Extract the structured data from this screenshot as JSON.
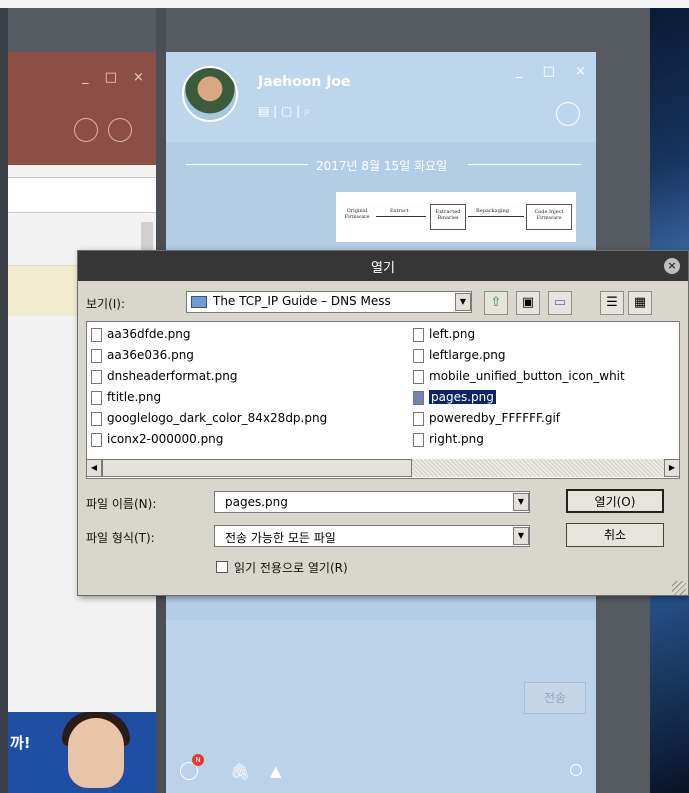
{
  "chat": {
    "username": "Jaehoon Joe",
    "toolbar_icons": "▤ | ▢ | ⌕",
    "window_controls": "_ □ ×",
    "date": "2017년 8월 15일 화요일",
    "send_label": "전송",
    "emoji_badge": "N",
    "diagram": {
      "box1": "Original Firmware",
      "arrow1": "Extract",
      "box2": "Extracted Binaries",
      "arrow2": "Repackaging",
      "box3": "Code Inject Firmware"
    }
  },
  "left_window": {
    "controls": "_ □ ×",
    "ad_text": "까!"
  },
  "dialog": {
    "title": "열기",
    "close_glyph": "×",
    "lookin_label": "보기(I):",
    "lookin_value": "The TCP_IP Guide – DNS Mess",
    "files_col1": [
      "aa36dfde.png",
      "aa36e036.png",
      "dnsheaderformat.png",
      "ftitle.png",
      "googlelogo_dark_color_84x28dp.png",
      "iconx2-000000.png"
    ],
    "files_col2": [
      "left.png",
      "leftlarge.png",
      "mobile_unified_button_icon_whit",
      "pages.png",
      "poweredby_FFFFFF.gif",
      "right.png"
    ],
    "selected_file": "pages.png",
    "filename_label": "파일 이름(N):",
    "filename_value": "pages.png",
    "filetype_label": "파일 형식(T):",
    "filetype_value": "전송 가능한 모든 파일",
    "open_label": "열기(O)",
    "cancel_label": "취소",
    "readonly_label": "읽기 전용으로 열기(R)",
    "colors": {
      "title_bar": "#363636",
      "selection": "#0a246a",
      "dialog_bg": "#d9d6cd"
    }
  }
}
